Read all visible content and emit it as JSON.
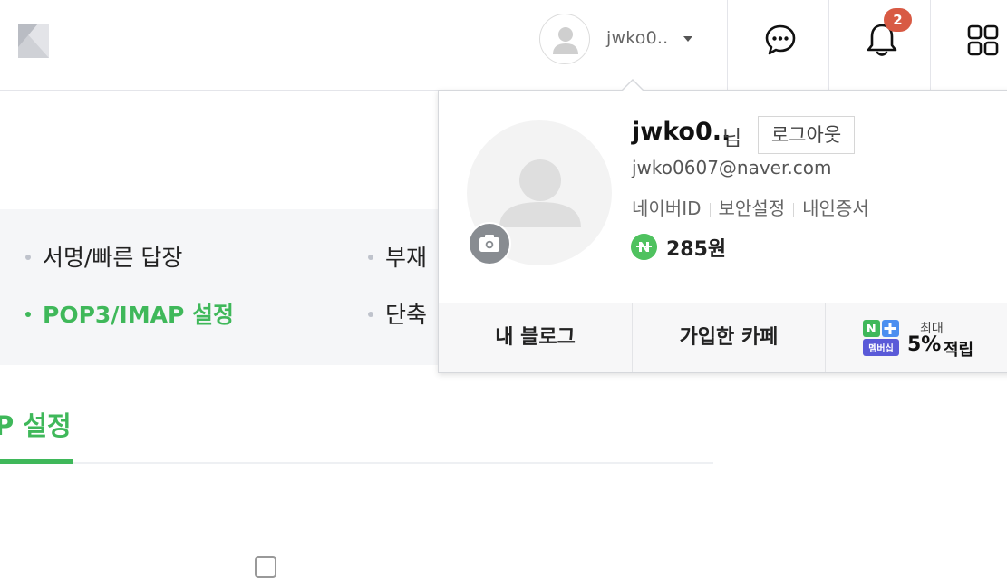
{
  "header": {
    "user_name": "jwko0..",
    "notification_count": "2"
  },
  "settings_menu": {
    "items": [
      {
        "label": "서명/빠른 답장",
        "active": false
      },
      {
        "label": "부재",
        "active": false
      },
      {
        "label": "POP3/IMAP 설정",
        "active": true
      },
      {
        "label": "단축",
        "active": false
      }
    ]
  },
  "section": {
    "title": "P 설정"
  },
  "profile_popup": {
    "name": "jwko0..",
    "name_suffix": "님",
    "logout_label": "로그아웃",
    "email": "jwko0607@naver.com",
    "links": [
      "네이버ID",
      "보안설정",
      "내인증서"
    ],
    "points": "285원",
    "footer": {
      "blog_label": "내 블로그",
      "cafe_label": "가입한 카페",
      "membership_top": "최대",
      "membership_value": "5%",
      "membership_suffix": "적립",
      "nplus_badge": "멤버십"
    }
  },
  "colors": {
    "accent_green": "#3fb85a",
    "badge_red": "#d85a44",
    "npay_green": "#4fc25f"
  }
}
